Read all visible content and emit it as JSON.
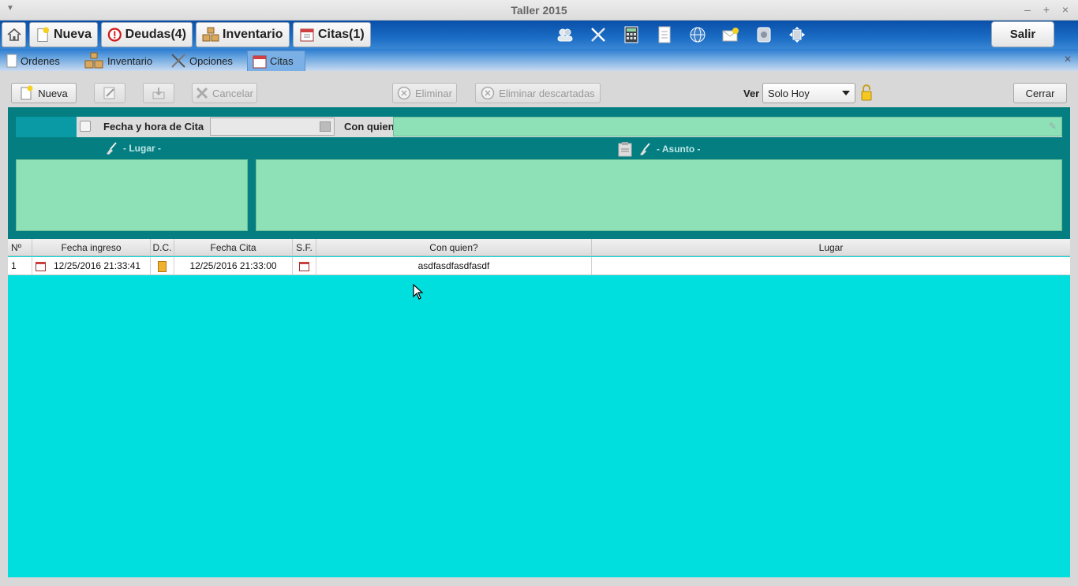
{
  "window": {
    "title": "Taller 2015"
  },
  "banner": {
    "buttons": [
      {
        "label": "Nueva",
        "icon": "new-document-star-icon"
      },
      {
        "label": "Deudas(4)",
        "icon": "warning-circle-icon"
      },
      {
        "label": "Inventario",
        "icon": "boxes-icon"
      },
      {
        "label": "Citas(1)",
        "icon": "calendar-icon"
      }
    ],
    "tools": [
      "users-icon",
      "tools-icon",
      "calculator-icon",
      "document-icon",
      "globe-icon",
      "mail-star-icon",
      "gears-icon",
      "network-icon"
    ],
    "exit_label": "Salir"
  },
  "tabs": {
    "items": [
      {
        "label": "Ordenes",
        "icon": "document-icon"
      },
      {
        "label": "Inventario",
        "icon": "boxes-icon"
      },
      {
        "label": "Opciones",
        "icon": "tools-icon"
      },
      {
        "label": "Citas",
        "icon": "calendar-icon"
      }
    ],
    "active_index": 3
  },
  "toolbar": {
    "new_label": "Nueva",
    "cancel_label": "Cancelar",
    "delete_label": "Eliminar",
    "delete_discarded_label": "Eliminar descartadas",
    "ver_label": "Ver",
    "ver_value": "Solo Hoy",
    "close_label": "Cerrar"
  },
  "form": {
    "date_label": "Fecha y hora de Cita",
    "date_value": "",
    "with_label": "Con quien",
    "with_value": "",
    "place_label": "- Lugar -",
    "subject_label": "- Asunto -"
  },
  "table": {
    "headers": [
      "Nº",
      "Fecha ingreso",
      "D.C.",
      "Fecha Cita",
      "S.F.",
      "Con quien?",
      "Lugar"
    ],
    "rows": [
      {
        "n": "1",
        "fecha_ingreso": "12/25/2016 21:33:41",
        "fecha_cita": "12/25/2016 21:33:00",
        "con_quien": "asdfasdfasdfasdf",
        "lugar": ""
      }
    ]
  },
  "colors": {
    "banner": "#1a6cc4",
    "form_panel": "#047e80",
    "field_green": "#8ee0b6",
    "table_bg": "#00dede"
  }
}
